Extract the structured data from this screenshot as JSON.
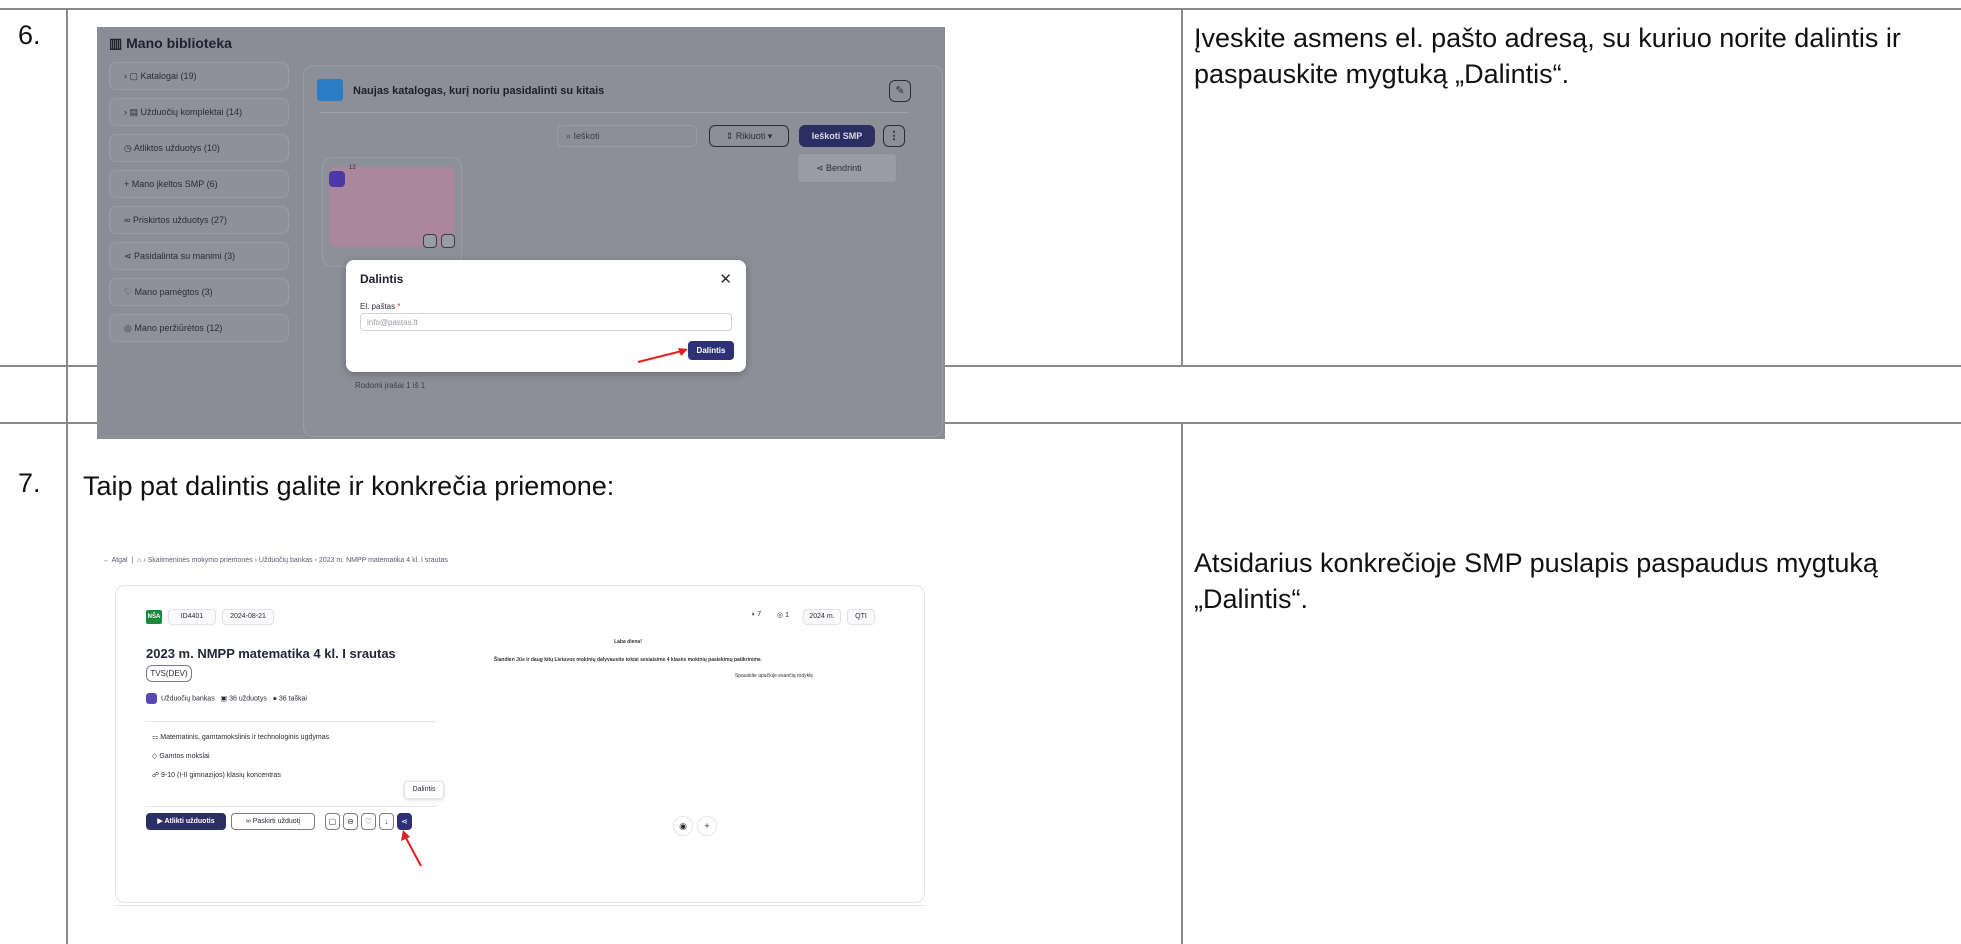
{
  "rows": {
    "row6": {
      "number": "6.",
      "instruction": "Įveskite asmens el. pašto adresą, su kuriuo norite dalintis ir paspauskite mygtuką „Dalintis“."
    },
    "row7": {
      "number": "7.",
      "text": "Taip pat dalintis galite ir konkrečia priemone:"
    },
    "row8": {
      "instruction": "Atsidarius konkrečioje SMP puslapis paspaudus mygtuką „Dalintis“."
    }
  },
  "screenshot1": {
    "title": "Mano biblioteka",
    "sidebar": [
      "Katalogai (19)",
      "Užduočių komplektai (14)",
      "Atliktos užduotys (10)",
      "Mano įkeltos SMP (6)",
      "Priskirtos užduotys (27)",
      "Pasidalinta su manimi (3)",
      "Mano pamėgtos (3)",
      "Mano peržiūrėtos (12)"
    ],
    "folder_title": "Naujas katalogas, kurį noriu pasidalinti su kitais",
    "search_placeholder": "Ieškoti",
    "sort_label": "Rikiuoti",
    "search_smp_label": "Ieškoti SMP",
    "share_menu_label": "Bendrinti",
    "card_badge": "12",
    "bottom_text": "Rodomi įrašai 1 iš 1",
    "modal": {
      "title": "Dalintis",
      "field_label": "El. paštas",
      "required_mark": "*",
      "placeholder": "info@pastas.lt",
      "submit": "Dalintis"
    },
    "arrow_color": "#e02020"
  },
  "screenshot2": {
    "breadcrumb": {
      "back": "Atgal",
      "item1": "Skaitmeninės mokymo priemonės",
      "item2": "Užduočių bankas",
      "item3": "2023 m. NMPP matematika 4 kl. I srautas"
    },
    "logo_text": "NŠA",
    "id": "ID4401",
    "date": "2024-08-21",
    "likes": "7",
    "views": "1",
    "year": "2024 m.",
    "format": "QTI",
    "title": "2023 m. NMPP matematika 4 kl. I srautas",
    "tag": "TVS(DEV)",
    "meta_bank": "Užduočių bankas",
    "meta_tasks": "36 užduotys",
    "meta_points": "36 taškai",
    "subject_area": "Matematinis, gamtamokslinis ir technologinis ugdymas",
    "subject": "Gamtos mokslai",
    "grade": "9-10 (I-II gimnazijos) klasių koncentras",
    "preview_greeting": "Laba diena!",
    "preview_body": "Šiandien Jūs ir daug kitų Lietuvos mokinių dalyvausite tokiai sesiaisime 4 klasės mokinių pasiekimų patikrinime.",
    "preview_hint": "Spauskite apačioje esančią rodyklę",
    "btn_start": "Atlikti užduotis",
    "btn_assign": "Paskirti užduotį",
    "tooltip": "Dalintis",
    "arrow_color": "#e02020"
  }
}
